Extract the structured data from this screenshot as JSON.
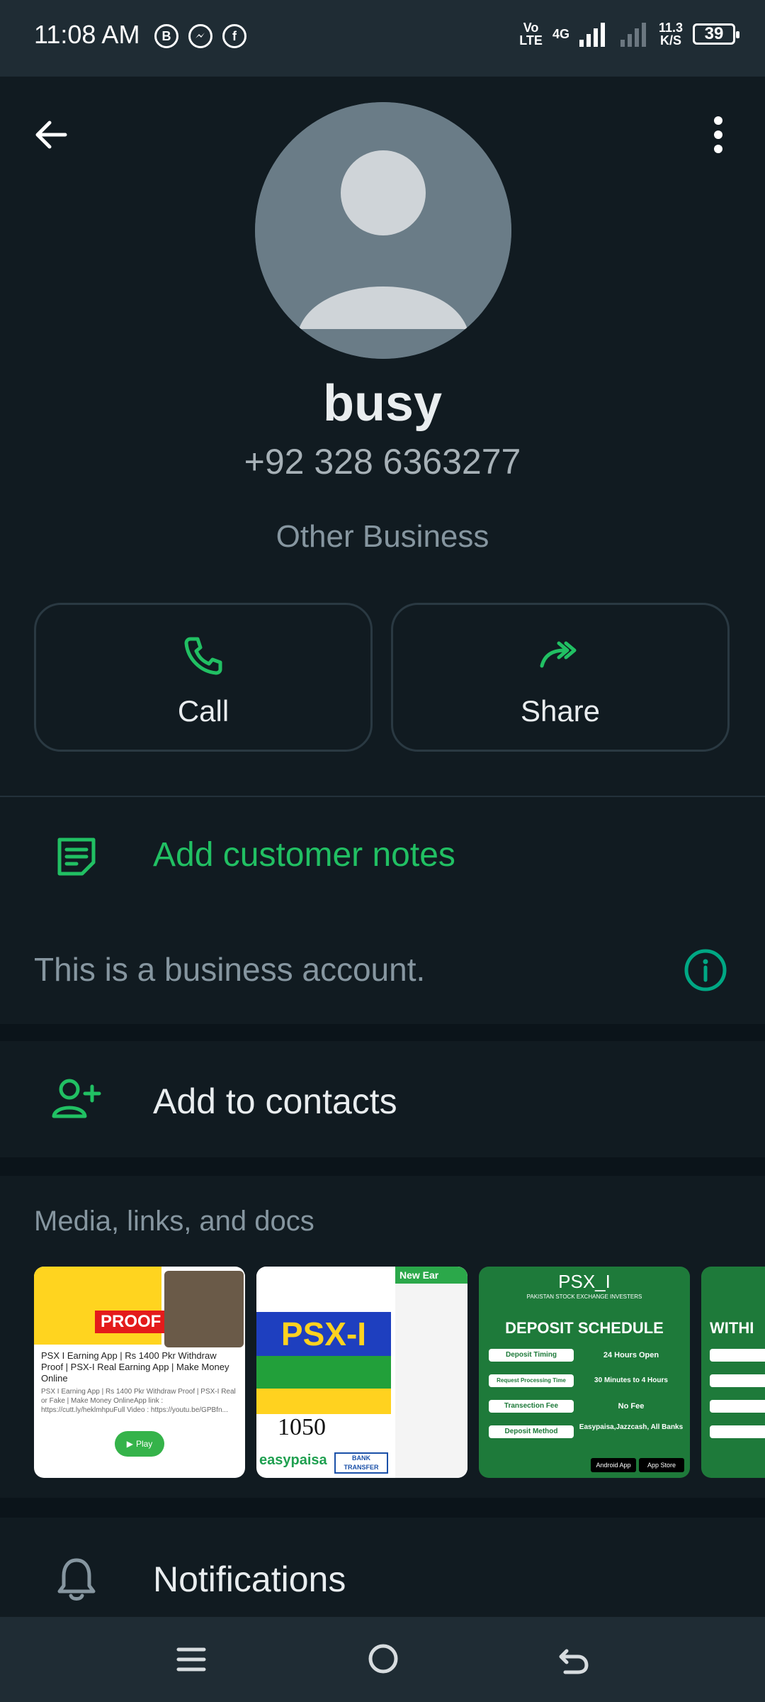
{
  "status_bar": {
    "time": "11:08 AM",
    "left_icons": [
      "B",
      "messenger",
      "f"
    ],
    "network_label_top": "Vo",
    "network_label_bottom": "LTE",
    "network_type": "4G",
    "speed_value": "11.3",
    "speed_unit": "K/S",
    "battery": "39"
  },
  "profile": {
    "name": "busy",
    "phone": "+92 328 6363277",
    "category": "Other Business"
  },
  "actions": {
    "call_label": "Call",
    "share_label": "Share"
  },
  "notes": {
    "label": "Add customer notes"
  },
  "business_info": {
    "label": "This is a business account."
  },
  "contacts": {
    "label": "Add to contacts"
  },
  "media": {
    "title": "Media, links, and docs",
    "thumb1": {
      "headline": "PSX I Earning App | Rs 1400 Pkr Withdraw Proof | PSX-I Real Earning App | Make Money Online",
      "desc": "PSX I Earning App | Rs 1400 Pkr Withdraw Proof | PSX-I Real or Fake | Make Money OnlineApp link : https://cutt.ly/heklmhpuFull Video : https://youtu.be/GPBfn...",
      "play": "Play",
      "proof": "PROOF"
    },
    "thumb2": {
      "brand": "PSX-I",
      "amount": "1050",
      "new_label": "New Ear",
      "bank": "BANK TRANSFER",
      "easypaisa": "easypaisa"
    },
    "thumb3": {
      "brand": "PSX_I",
      "subtitle": "PAKISTAN STOCK EXCHANGE INVESTERS",
      "heading": "DEPOSIT SCHEDULE",
      "rows": [
        {
          "k": "Deposit Timing",
          "v": "24 Hours Open"
        },
        {
          "k": "Request Processing Time",
          "v": "30 Minutes to 4 Hours"
        },
        {
          "k": "Transection Fee",
          "v": "No Fee"
        },
        {
          "k": "Deposit Method",
          "v": "Easypaisa,Jazzcash, All Banks"
        }
      ],
      "android": "Android App",
      "appstore": "App Store"
    },
    "thumb4": {
      "heading": "WITHI"
    }
  },
  "notifications": {
    "label": "Notifications"
  },
  "colors": {
    "accent_green": "#21c063",
    "background": "#111b21",
    "secondary_text": "#8696a0"
  }
}
